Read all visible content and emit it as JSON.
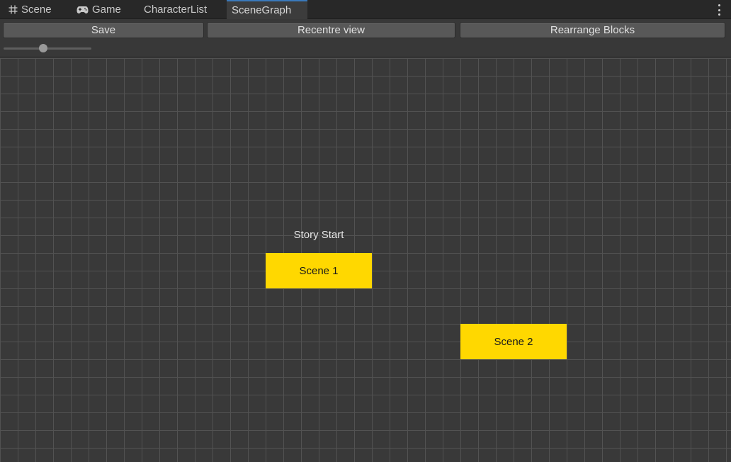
{
  "tabs": [
    {
      "label": "Scene",
      "icon": "grid-icon",
      "active": false
    },
    {
      "label": "Game",
      "icon": "gamepad-icon",
      "active": false
    },
    {
      "label": "CharacterList",
      "icon": "",
      "active": false
    },
    {
      "label": "SceneGraph",
      "icon": "",
      "active": true
    }
  ],
  "toolbar": {
    "save_label": "Save",
    "recentre_label": "Recentre view",
    "rearrange_label": "Rearrange Blocks",
    "zoom_level": 0.45
  },
  "graph": {
    "start_caption": "Story Start",
    "nodes": [
      {
        "label": "Scene 1"
      },
      {
        "label": "Scene 2"
      }
    ]
  },
  "colors": {
    "node_fill": "#ffd800",
    "active_tab_accent": "#3a79bb",
    "canvas_bg": "#393939",
    "grid_line": "#525252"
  }
}
